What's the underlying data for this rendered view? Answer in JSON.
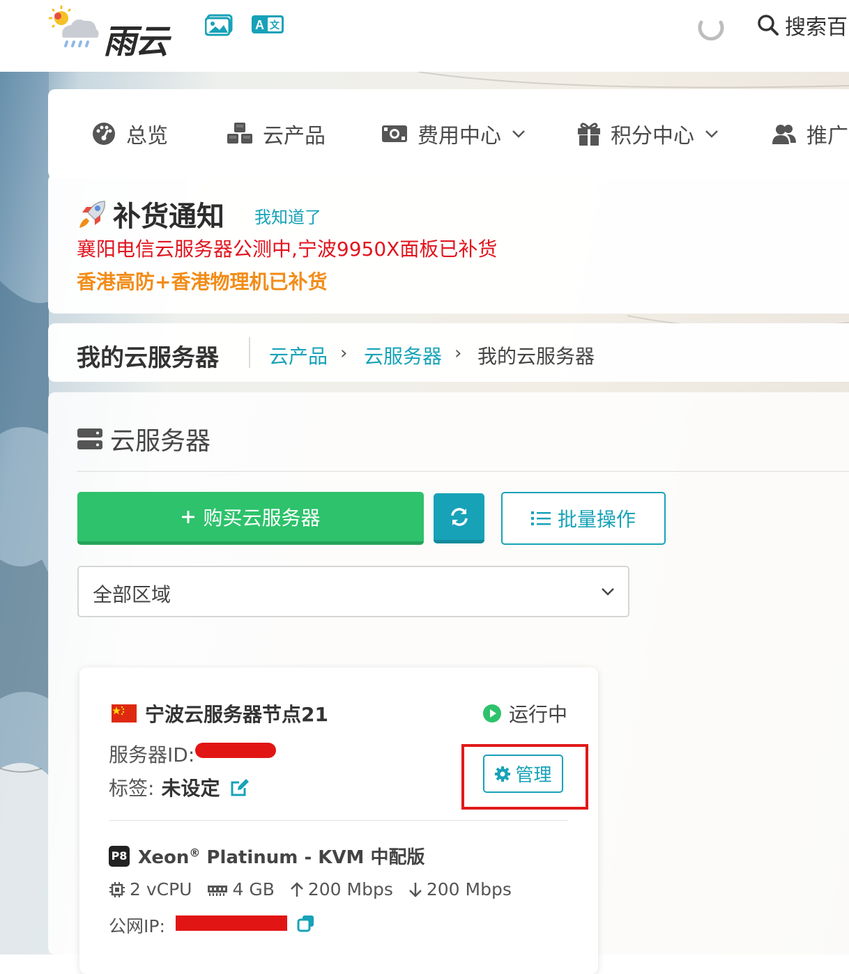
{
  "header": {
    "logo_text": "雨云",
    "logo_icon": "weather-cloud-sun-rain-icon",
    "image_icon": "image-icon",
    "translate_icon": "translate-icon",
    "loading_icon": "loading-spinner-icon",
    "search_label": "搜索百"
  },
  "nav": {
    "items": [
      {
        "label": "总览",
        "icon": "dashboard-icon"
      },
      {
        "label": "云产品",
        "icon": "cubes-icon"
      },
      {
        "label": "费用中心",
        "icon": "money-bill-icon",
        "dropdown": true
      },
      {
        "label": "积分中心",
        "icon": "gift-icon",
        "dropdown": true
      },
      {
        "label": "推广",
        "icon": "users-icon"
      }
    ]
  },
  "notice": {
    "title": "补货通知",
    "ack_label": "我知道了",
    "line1": "襄阳电信云服务器公测中,宁波9950X面板已补货",
    "line2": "香港高防+香港物理机已补货",
    "line1_color": "#e0141e",
    "line2_color": "#f28c18"
  },
  "breadcrumb": {
    "page_title": "我的云服务器",
    "items": [
      "云产品",
      "云服务器",
      "我的云服务器"
    ]
  },
  "section": {
    "title": "云服务器",
    "buy_label": "购买云服务器",
    "batch_label": "批量操作",
    "region_select": "全部区域"
  },
  "server": {
    "name": "宁波云服务器节点21",
    "status": "运行中",
    "id_label": "服务器ID:",
    "tag_label": "标签:",
    "tag_value": "未设定",
    "manage_label": "管理",
    "plan_badge": "P8",
    "plan_name": "Xeon",
    "plan_reg": "®",
    "plan_rest": "Platinum - KVM 中配版",
    "cpu": "2 vCPU",
    "ram": "4 GB",
    "up": "200 Mbps",
    "down": "200 Mbps",
    "ip_label": "公网IP:"
  },
  "colors": {
    "accent": "#17a2b8",
    "buy_green": "#2dc26b",
    "highlight_red": "#e01a1a"
  }
}
